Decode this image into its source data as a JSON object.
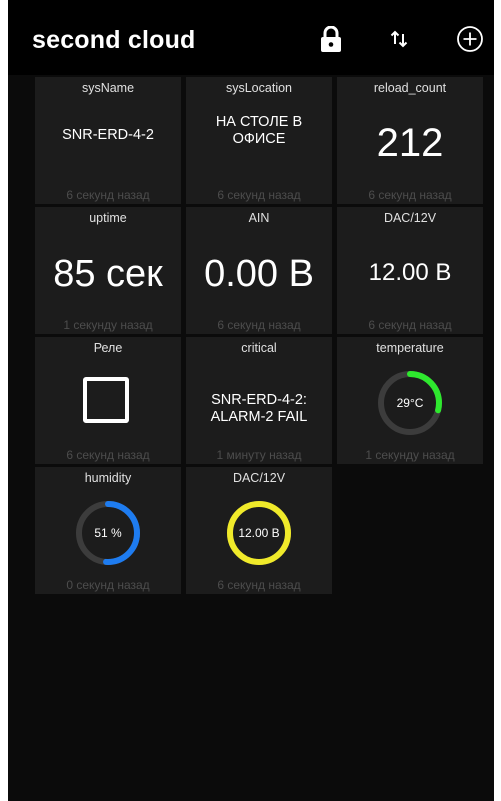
{
  "app": {
    "title": "second cloud",
    "actions": [
      {
        "icon": "lock-icon"
      },
      {
        "icon": "sort-arrows-icon"
      },
      {
        "icon": "plus-circle-icon"
      }
    ]
  },
  "tiles": [
    {
      "label": "sysName",
      "value": "SNR-ERD-4-2",
      "time": "6 секунд назад"
    },
    {
      "label": "sysLocation",
      "value": "НА СТОЛЕ В ОФИСЕ",
      "time": "6 секунд назад"
    },
    {
      "label": "reload_count",
      "value": "212",
      "time": "6 секунд назад"
    },
    {
      "label": "uptime",
      "value": "85 сек",
      "time": "1 секунду назад"
    },
    {
      "label": "AIN",
      "value": "0.00 В",
      "time": "6 секунд назад"
    },
    {
      "label": "DAC/12V",
      "value": "12.00 В",
      "time": "6 секунд назад"
    },
    {
      "label": "Реле",
      "checked": false,
      "time": "6 секунд назад"
    },
    {
      "label": "critical",
      "value": "SNR-ERD-4-2: ALARM-2 FAIL",
      "time": "1 минуту назад"
    },
    {
      "label": "temperature",
      "value": "29°C",
      "fraction": 0.29,
      "color": "#2ee82e",
      "time": "1 секунду назад"
    },
    {
      "label": "humidity",
      "value": "51 %",
      "fraction": 0.51,
      "color": "#1e7cf0",
      "time": "0 секунд назад"
    },
    {
      "label": "DAC/12V",
      "value": "12.00 В",
      "fraction": 1.0,
      "color": "#f0ea2a",
      "time": "6 секунд назад"
    }
  ],
  "colors": {
    "background": "#0b0b0b",
    "tile": "#1c1c1c",
    "gauge_track": "#3c3c3c"
  }
}
